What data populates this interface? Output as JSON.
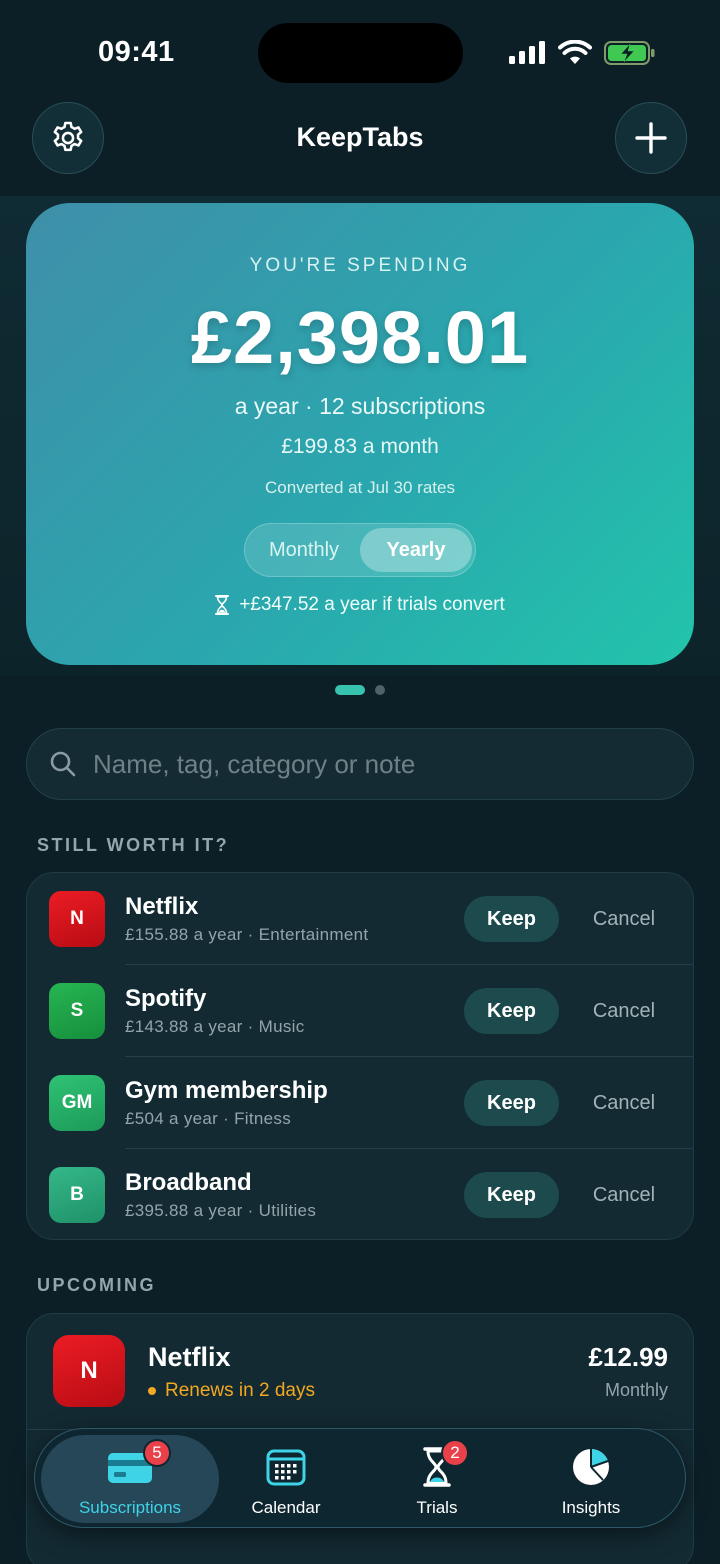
{
  "status_bar": {
    "time": "09:41"
  },
  "header": {
    "title": "KeepTabs"
  },
  "hero": {
    "label": "YOU'RE SPENDING",
    "amount": "£2,398.01",
    "summary": "a year · 12 subscriptions",
    "monthly": "£199.83 a month",
    "rates_note": "Converted at Jul 30 rates",
    "toggle": {
      "options": [
        "Monthly",
        "Yearly"
      ],
      "selected": "Yearly"
    },
    "trial_note": "+£347.52 a year if trials convert"
  },
  "pager": {
    "pages": 2,
    "current": 1
  },
  "search": {
    "placeholder": "Name, tag, category or note",
    "value": ""
  },
  "worth_section": {
    "title": "STILL WORTH IT?",
    "keep_label": "Keep",
    "cancel_label": "Cancel",
    "items": [
      {
        "initials": "N",
        "name": "Netflix",
        "meta": "£155.88 a year · Entertainment",
        "color": "#d8121b"
      },
      {
        "initials": "S",
        "name": "Spotify",
        "meta": "£143.88 a year · Music",
        "color": "#1fa84a"
      },
      {
        "initials": "GM",
        "name": "Gym membership",
        "meta": "£504 a year · Fitness",
        "color": "#23b26a"
      },
      {
        "initials": "B",
        "name": "Broadband",
        "meta": "£395.88 a year · Utilities",
        "color": "#2aa77d"
      }
    ]
  },
  "upcoming_section": {
    "title": "UPCOMING",
    "items": [
      {
        "initials": "N",
        "name": "Netflix",
        "renews": "Renews in 2 days",
        "price": "£12.99",
        "period": "Monthly",
        "color": "#d8121b"
      }
    ]
  },
  "tabbar": {
    "tabs": [
      {
        "label": "Subscriptions",
        "badge": "5",
        "icon": "card-icon",
        "active": true
      },
      {
        "label": "Calendar",
        "badge": "",
        "icon": "calendar-icon",
        "active": false
      },
      {
        "label": "Trials",
        "badge": "2",
        "icon": "hourglass-icon",
        "active": false
      },
      {
        "label": "Insights",
        "badge": "",
        "icon": "pie-chart-icon",
        "active": false
      }
    ]
  },
  "colors": {
    "accent": "#37c3ae",
    "warning": "#f2a81f",
    "badge": "#e8414a"
  }
}
